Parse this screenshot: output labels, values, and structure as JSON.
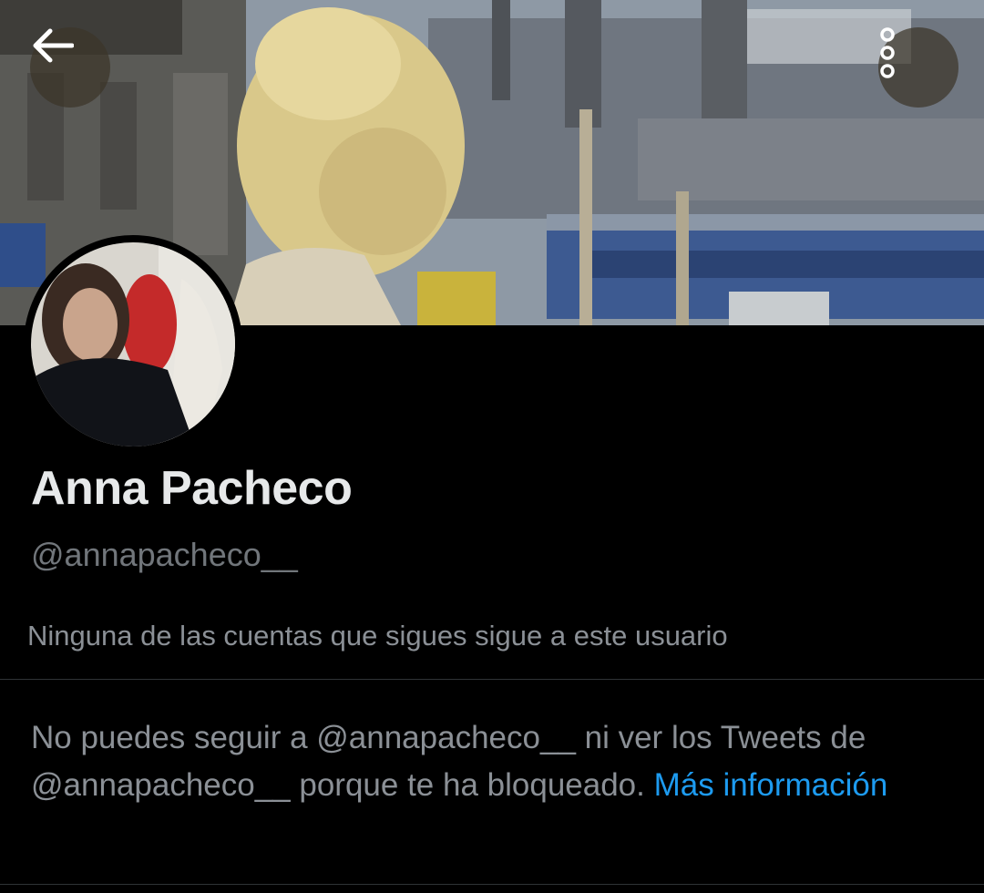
{
  "header": {
    "back_icon": "arrow-left-icon",
    "more_icon": "more-vertical-icon"
  },
  "profile": {
    "display_name": "Anna Pacheco",
    "handle": "@annapacheco__",
    "followers_you_know": "Ninguna de las cuentas que sigues sigue a este usuario"
  },
  "blocked": {
    "text": "No puedes seguir a @annapacheco__ ni ver los Tweets de @annapacheco__ porque te ha bloqueado. ",
    "link_label": "Más información"
  },
  "colors": {
    "background": "#000000",
    "text_primary": "#e7e9ea",
    "text_secondary": "#71767b",
    "link": "#1d9bf0",
    "divider": "#2f3336"
  }
}
